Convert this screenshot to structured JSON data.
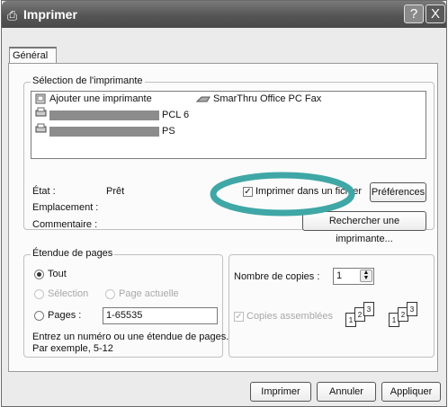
{
  "window": {
    "title": "Imprimer",
    "help_label": "?",
    "close_label": "X"
  },
  "tabs": {
    "general": "Général"
  },
  "printer_selection": {
    "legend": "Sélection de l'imprimante",
    "items": [
      {
        "label": "Ajouter une imprimante",
        "icon": "add-printer-icon"
      },
      {
        "label": "SmarThru Office PC Fax",
        "icon": "fax-icon"
      },
      {
        "label": "PCL 6",
        "icon": "printer-icon",
        "name_redacted": true
      },
      {
        "label": "PS",
        "icon": "printer-icon",
        "name_redacted": true
      }
    ],
    "status_label": "État :",
    "status_value": "Prêt",
    "location_label": "Emplacement :",
    "comment_label": "Commentaire :",
    "print_to_file_label": "Imprimer dans un fichier",
    "print_to_file_checked": true,
    "preferences_button": "Préférences",
    "find_printer_button": "Rechercher une imprimante..."
  },
  "page_range": {
    "legend": "Étendue de pages",
    "all_label": "Tout",
    "selection_label": "Sélection",
    "current_page_label": "Page actuelle",
    "pages_label": "Pages :",
    "pages_value": "1-65535",
    "selected": "all",
    "hint_line1": "Entrez un numéro ou une étendue de pages.",
    "hint_line2": "Par exemple, 5-12"
  },
  "copies": {
    "count_label": "Nombre de copies :",
    "count_value": "1",
    "collate_label": "Copies assemblées",
    "collate_checked": true,
    "collate_page_numbers": [
      "1",
      "2",
      "3"
    ]
  },
  "footer": {
    "print_button": "Imprimer",
    "cancel_button": "Annuler",
    "apply_button": "Appliquer"
  },
  "colors": {
    "annotation_ellipse": "#3fa7a6",
    "titlebar": "#5a5a5a"
  }
}
